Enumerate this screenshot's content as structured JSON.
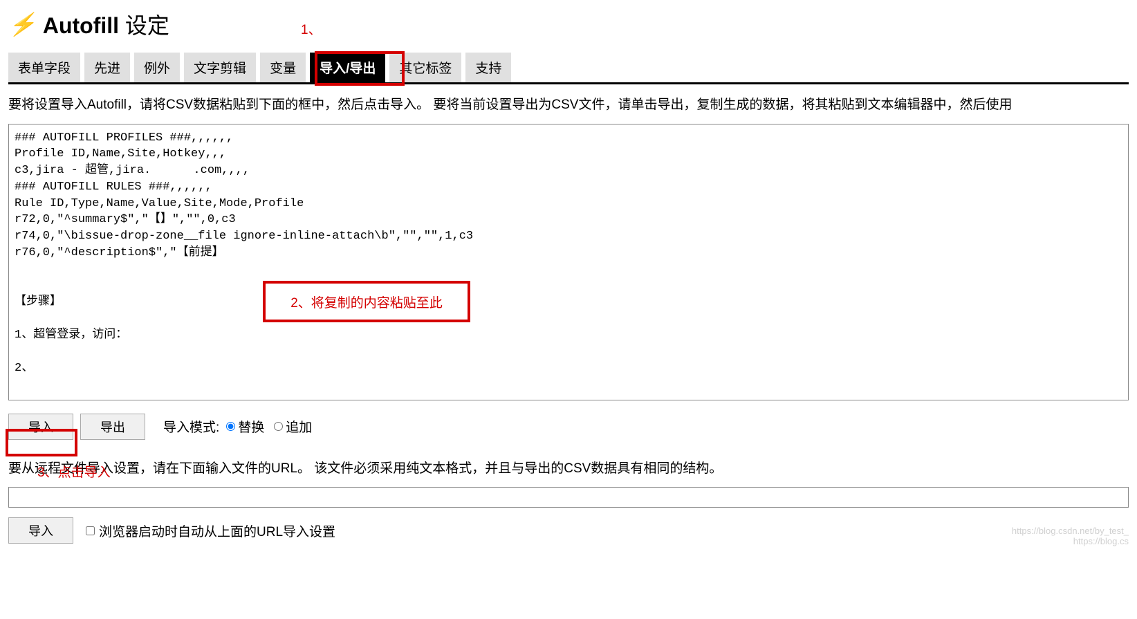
{
  "header": {
    "title_bold": "Autofill",
    "title_rest": " 设定"
  },
  "tabs": {
    "items": [
      "表单字段",
      "先进",
      "例外",
      "文字剪辑",
      "变量",
      "导入/导出",
      "其它标签",
      "支持"
    ],
    "active_index": 5
  },
  "instructions_top": "要将设置导入Autofill，请将CSV数据粘贴到下面的框中，然后点击导入。 要将当前设置导出为CSV文件，请单击导出，复制生成的数据，将其粘贴到文本编辑器中，然后使用",
  "textarea_content": "### AUTOFILL PROFILES ###,,,,,,\nProfile ID,Name,Site,Hotkey,,,\nc3,jira - 超管,jira.      .com,,,,\n### AUTOFILL RULES ###,,,,,,\nRule ID,Type,Name,Value,Site,Mode,Profile\nr72,0,\"^summary$\",\"【】\",\"\",0,c3\nr74,0,\"\\bissue-drop-zone__file ignore-inline-attach\\b\",\"\",\"\",1,c3\nr76,0,\"^description$\",\"【前提】\n\n\n【步骤】\n\n1、超管登录，访问：\n\n2、",
  "buttons": {
    "import": "导入",
    "export": "导出"
  },
  "import_mode": {
    "label": "导入模式:",
    "options": [
      "替换",
      "追加"
    ],
    "selected_index": 0
  },
  "instructions_url": "要从远程文件导入设置，请在下面输入文件的URL。 该文件必须采用纯文本格式，并且与导出的CSV数据具有相同的结构。",
  "url_input_value": "",
  "bottom": {
    "import_button": "导入",
    "checkbox_label": "浏览器启动时自动从上面的URL导入设置"
  },
  "annotations": {
    "step1": "1、",
    "step2": "2、将复制的内容粘贴至此",
    "step3": "3、点击导入"
  },
  "watermark": "https://blog.csdn.net/by_test_\nhttps://blog.cs"
}
